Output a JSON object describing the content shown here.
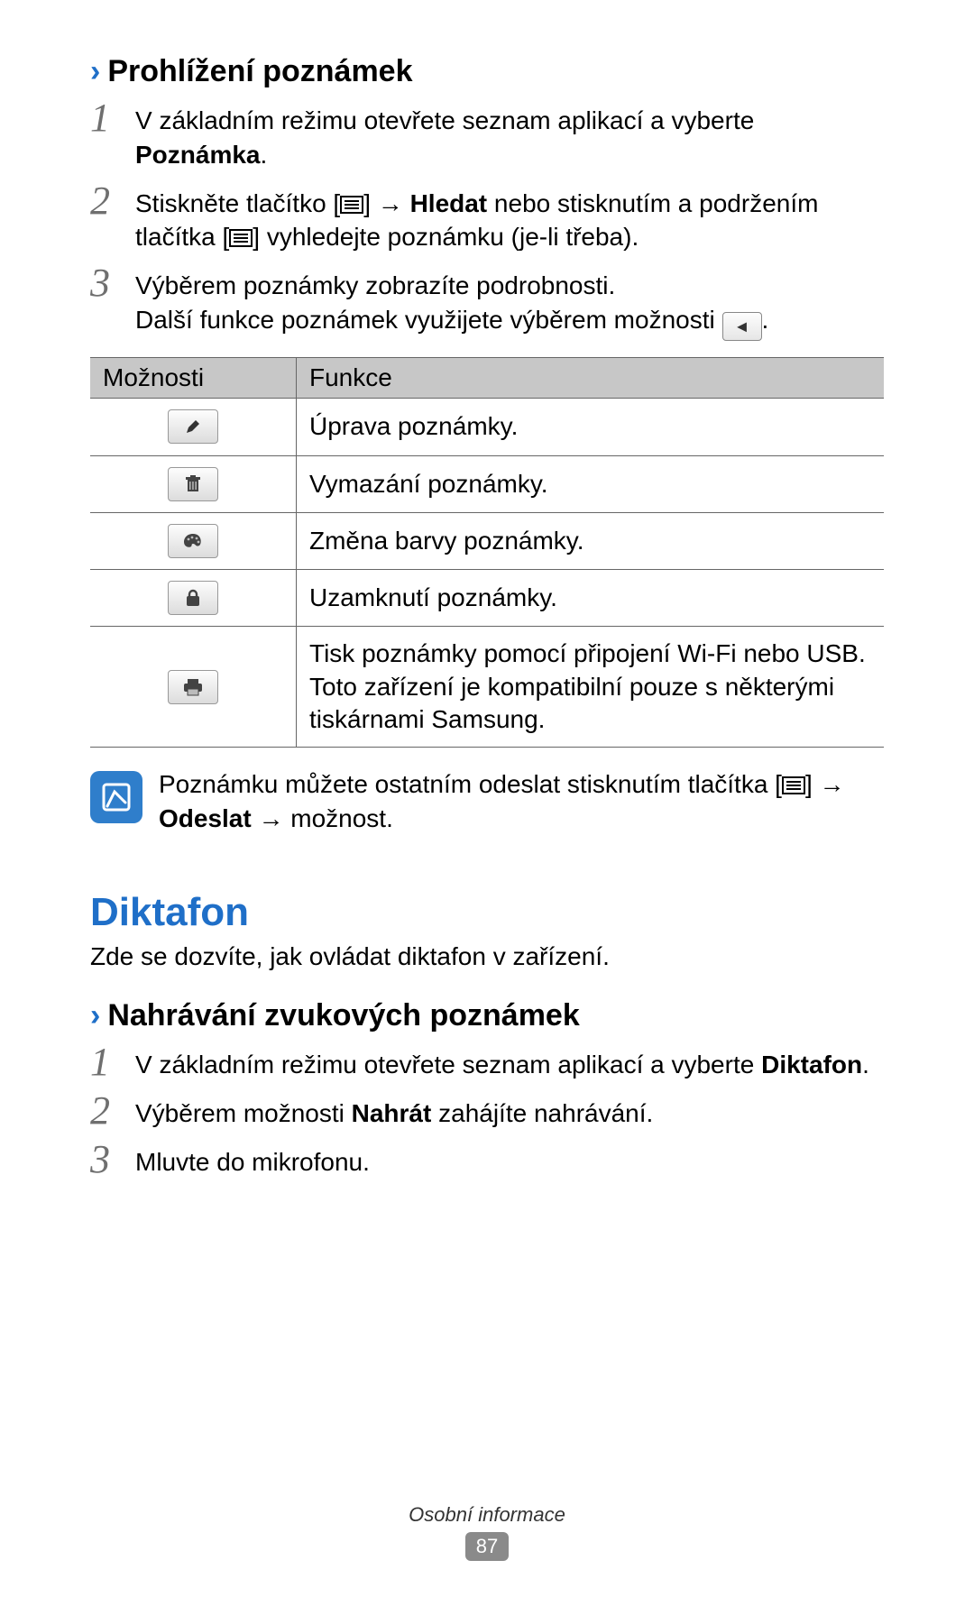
{
  "sec1": {
    "heading": "Prohlížení poznámek",
    "step1_a": "V základním režimu otevřete seznam aplikací a vyberte ",
    "step1_b": "Poznámka",
    "step1_c": ".",
    "step2_a": "Stiskněte tlačítko [",
    "step2_b": "] → ",
    "step2_c": "Hledat",
    "step2_d": " nebo stisknutím a podržením tlačítka [",
    "step2_e": "] vyhledejte poznámku (je-li třeba).",
    "step3_a": "Výběrem poznámky zobrazíte podrobnosti.",
    "step3_b": "Další funkce poznámek využijete výběrem možnosti ",
    "step3_c": "."
  },
  "table": {
    "h1": "Možnosti",
    "h2": "Funkce",
    "rows": [
      {
        "icon": "pencil",
        "text": "Úprava poznámky."
      },
      {
        "icon": "trash",
        "text": "Vymazání poznámky."
      },
      {
        "icon": "palette",
        "text": "Změna barvy poznámky."
      },
      {
        "icon": "lock",
        "text": "Uzamknutí poznámky."
      },
      {
        "icon": "print",
        "text": "Tisk poznámky pomocí připojení Wi-Fi nebo USB. Toto zařízení je kompatibilní pouze s některými tiskárnami Samsung."
      }
    ]
  },
  "note": {
    "a": "Poznámku můžete ostatním odeslat stisknutím tlačítka [",
    "b": "] → ",
    "c": "Odeslat",
    "d": " → možnost."
  },
  "title2": "Diktafon",
  "intro2": "Zde se dozvíte, jak ovládat diktafon v zařízení.",
  "sec2": {
    "heading": "Nahrávání zvukových poznámek",
    "step1_a": "V základním režimu otevřete seznam aplikací a vyberte ",
    "step1_b": "Diktafon",
    "step1_c": ".",
    "step2_a": "Výběrem možnosti ",
    "step2_b": "Nahrát",
    "step2_c": " zahájíte nahrávání.",
    "step3": "Mluvte do mikrofonu."
  },
  "footer": {
    "section": "Osobní informace",
    "page": "87"
  }
}
